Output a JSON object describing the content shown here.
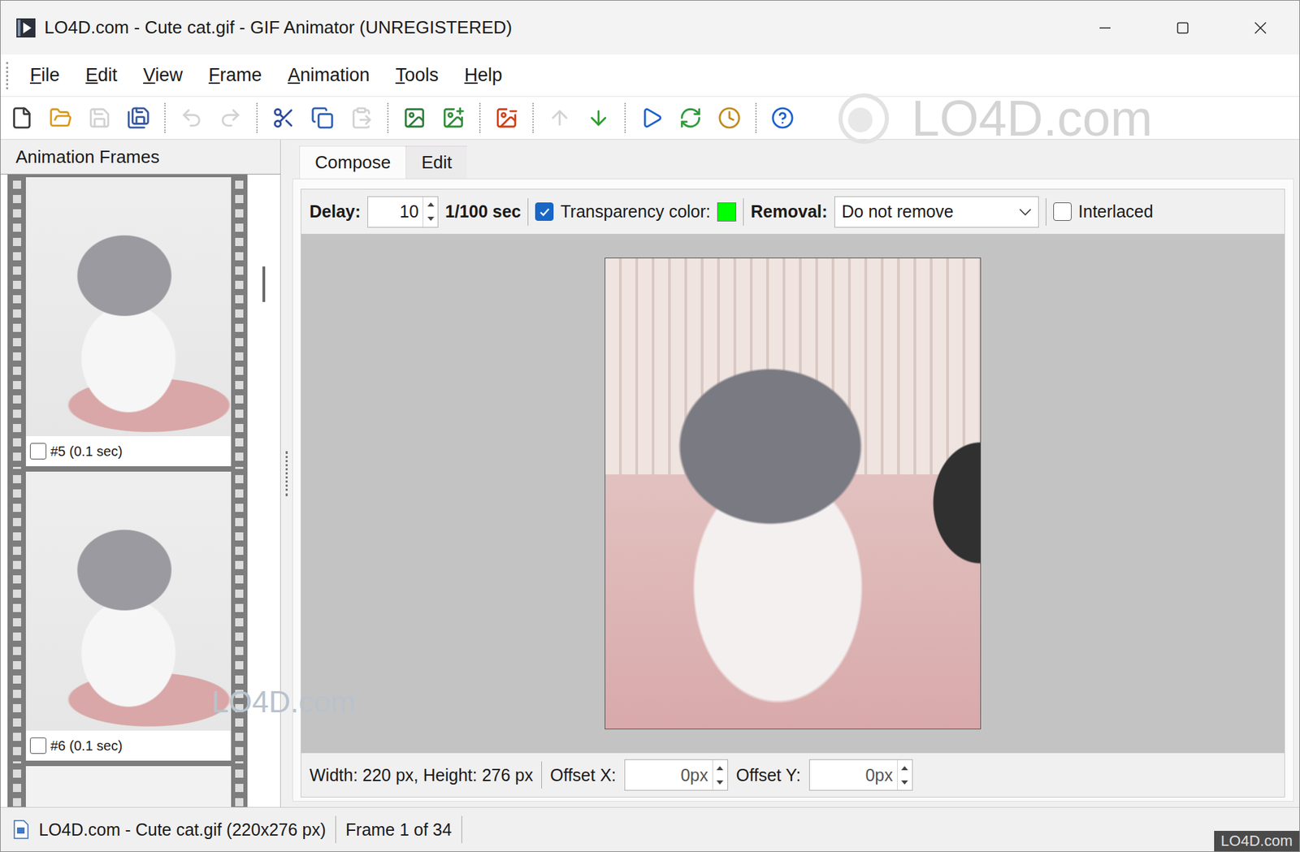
{
  "window": {
    "title": "LO4D.com - Cute cat.gif - GIF Animator (UNREGISTERED)"
  },
  "menu": [
    "File",
    "Edit",
    "View",
    "Frame",
    "Animation",
    "Tools",
    "Help"
  ],
  "toolbar": [
    [
      {
        "kind": "new",
        "disabled": false
      },
      {
        "kind": "open",
        "disabled": false
      },
      {
        "kind": "save",
        "disabled": true
      },
      {
        "kind": "properties",
        "disabled": false
      }
    ],
    [
      {
        "kind": "undo",
        "disabled": true
      },
      {
        "kind": "redo",
        "disabled": true
      }
    ],
    [
      {
        "kind": "cut",
        "disabled": false
      },
      {
        "kind": "copy",
        "disabled": false
      },
      {
        "kind": "paste",
        "disabled": true
      }
    ],
    [
      {
        "kind": "frame",
        "disabled": false
      },
      {
        "kind": "add-frame",
        "disabled": false
      }
    ],
    [
      {
        "kind": "delete-frame",
        "disabled": false
      }
    ],
    [
      {
        "kind": "move-up",
        "disabled": true
      },
      {
        "kind": "move-down",
        "disabled": false
      }
    ],
    [
      {
        "kind": "play",
        "disabled": false
      },
      {
        "kind": "loop",
        "disabled": false
      },
      {
        "kind": "timing",
        "disabled": false
      }
    ],
    [
      {
        "kind": "help",
        "disabled": false
      }
    ]
  ],
  "frames_panel": {
    "title": "Animation Frames",
    "frames": [
      {
        "label": "#5 (0.1 sec)",
        "checked": false
      },
      {
        "label": "#6 (0.1 sec)",
        "checked": false
      }
    ]
  },
  "tabs": [
    {
      "label": "Compose",
      "selected": true
    },
    {
      "label": "Edit",
      "selected": false
    }
  ],
  "frame_options": {
    "delay_label": "Delay:",
    "delay": "10",
    "delay_unit": "1/100 sec",
    "transparency": {
      "label": "Transparency color:",
      "checked": true,
      "color": "#00ff00"
    },
    "removal_label": "Removal:",
    "removal": "Do not remove",
    "interlaced": {
      "label": "Interlaced",
      "checked": false
    }
  },
  "frame_info": {
    "size": "Width: 220 px, Height: 276 px",
    "offset_x_label": "Offset X:",
    "offset_x": "0px",
    "offset_y_label": "Offset Y:",
    "offset_y": "0px"
  },
  "status_bar": {
    "file": "LO4D.com - Cute cat.gif (220x276 px)",
    "frame": "Frame 1 of 34"
  },
  "watermarks": [
    {
      "text": "LO4D.com",
      "kind": "toolbar"
    },
    {
      "text": "LO4D.com",
      "kind": "canvas"
    },
    {
      "text": "LO4D.com",
      "kind": "badge"
    }
  ]
}
